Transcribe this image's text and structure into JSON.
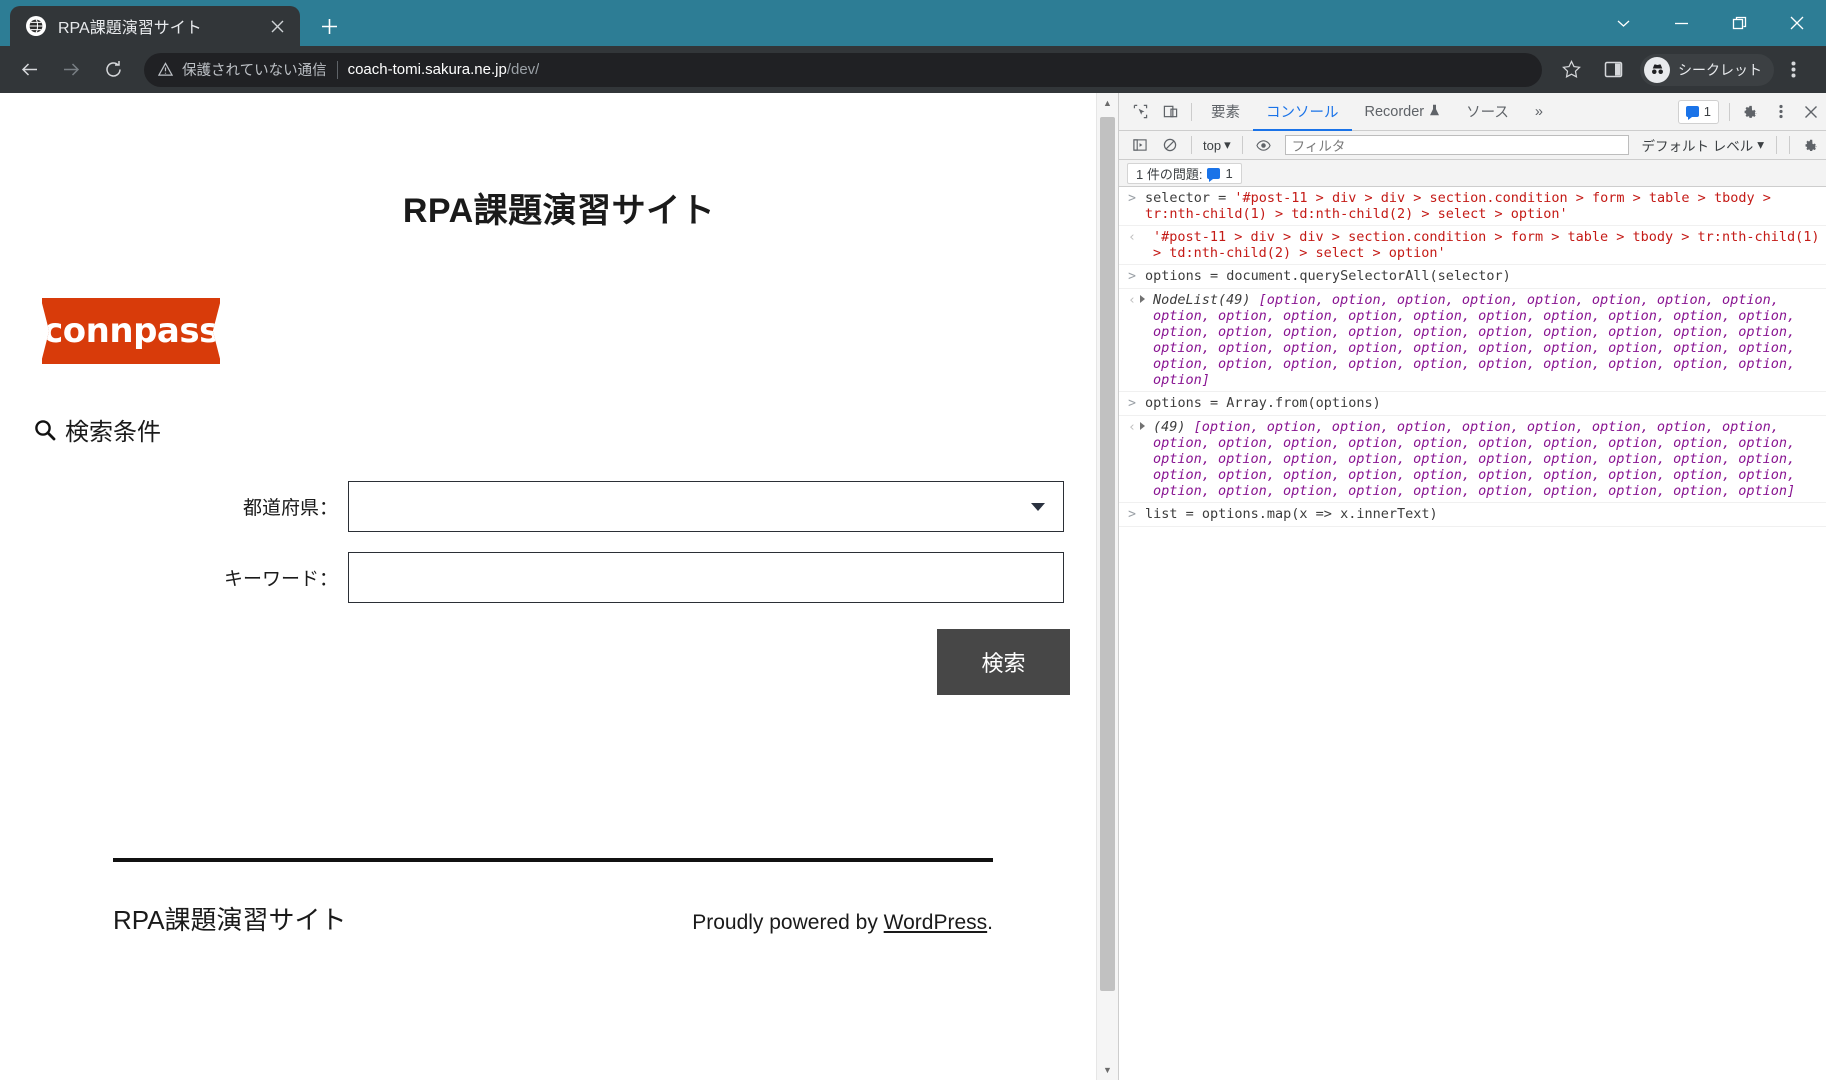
{
  "browser": {
    "tab": {
      "title": "RPA課題演習サイト",
      "favicon_icon": "globe-icon",
      "close_icon": "close-icon"
    },
    "new_tab_icon": "plus-icon",
    "window_controls": {
      "expand_icon": "chevron-down-icon",
      "minimize_icon": "minimize-icon",
      "maximize_icon": "maximize-icon",
      "close_icon": "close-icon"
    },
    "toolbar": {
      "back_icon": "back-arrow-icon",
      "forward_icon": "forward-arrow-icon",
      "reload_icon": "reload-icon",
      "security_icon": "warning-triangle-icon",
      "security_text": "保護されていない通信",
      "url_host": "coach-tomi.sakura.ne.jp",
      "url_path": "/dev/",
      "bookmark_icon": "star-icon",
      "sidepanel_icon": "side-panel-icon",
      "incognito_icon": "incognito-icon",
      "incognito_label": "シークレット",
      "menu_icon": "three-dot-menu-icon"
    }
  },
  "page": {
    "site_title": "RPA課題演習サイト",
    "logo_text": "connpass",
    "search_heading": {
      "icon": "magnifier-icon",
      "label": "検索条件"
    },
    "form": {
      "rows": [
        {
          "label": "都道府県：",
          "type": "select",
          "value": "",
          "caret_icon": "caret-down-icon"
        },
        {
          "label": "キーワード：",
          "type": "text",
          "value": "",
          "placeholder": ""
        }
      ],
      "submit_label": "検索"
    },
    "footer": {
      "site_name": "RPA課題演習サイト",
      "credit_prefix": "Proudly powered by ",
      "credit_link": "WordPress",
      "credit_suffix": "."
    },
    "scrollbar": {
      "up_icon": "scroll-up-icon",
      "down_icon": "scroll-down-icon"
    }
  },
  "devtools": {
    "toolbar": {
      "inspect_icon": "inspect-element-icon",
      "device_icon": "device-toolbar-icon",
      "settings_icon": "gear-icon",
      "more_icon": "three-dot-menu-icon",
      "close_icon": "close-icon",
      "issues_count": "1"
    },
    "tabs": [
      {
        "label": "要素",
        "active": false
      },
      {
        "label": "コンソール",
        "active": true
      },
      {
        "label": "Recorder",
        "active": false,
        "badge_icon": "flask-icon"
      },
      {
        "label": "ソース",
        "active": false
      },
      {
        "label": "»",
        "active": false
      }
    ],
    "console_toolbar": {
      "execute_icon": "sidebar-toggle-icon",
      "clear_icon": "clear-console-icon",
      "context": "top",
      "context_caret": "caret-down-icon",
      "eye_icon": "live-expression-eye-icon",
      "filter_placeholder": "フィルタ",
      "level": "デフォルト レベル",
      "level_caret": "caret-down-icon",
      "settings_icon": "gear-icon"
    },
    "issue_bar": {
      "label": "1 件の問題:",
      "count": "1",
      "bubble_icon": "issue-bubble-icon"
    },
    "console_lines": [
      {
        "kind": "input",
        "parts": [
          {
            "t": "plain",
            "v": "selector = "
          },
          {
            "t": "str",
            "v": "'#post-11 > div > div > section.condition > form > table > tbody > tr:nth-child(1) > td:nth-child(2) > select > option'"
          }
        ]
      },
      {
        "kind": "output",
        "parts": [
          {
            "t": "str",
            "v": "'#post-11 > div > div > section.condition > form > table > tbody > tr:nth-child(1) > td:nth-child(2) > select > option'"
          }
        ]
      },
      {
        "kind": "input",
        "parts": [
          {
            "t": "plain",
            "v": "options = document.querySelectorAll(selector)"
          }
        ]
      },
      {
        "kind": "output",
        "expandable": true,
        "parts": [
          {
            "t": "num",
            "v": "NodeList(49) "
          },
          {
            "t": "obj",
            "v": "[option, option, option, option, option, option, option, option, option, option, option, option, option, option, option, option, option, option, option, option, option, option, option, option, option, option, option, option, option, option, option, option, option, option, option, option, option, option, option, option, option, option, option, option, option, option, option, option, option]"
          }
        ]
      },
      {
        "kind": "input",
        "parts": [
          {
            "t": "plain",
            "v": "options = Array.from(options)"
          }
        ]
      },
      {
        "kind": "output",
        "expandable": true,
        "parts": [
          {
            "t": "num",
            "v": "(49) "
          },
          {
            "t": "obj",
            "v": "[option, option, option, option, option, option, option, option, option, option, option, option, option, option, option, option, option, option, option, option, option, option, option, option, option, option, option, option, option, option, option, option, option, option, option, option, option, option, option, option, option, option, option, option, option, option, option, option, option]"
          }
        ]
      },
      {
        "kind": "input",
        "parts": [
          {
            "t": "plain",
            "v": "list = options.map(x => x.innerText)"
          }
        ]
      }
    ]
  },
  "colors": {
    "tabstrip": "#2d7d95",
    "chrome_dark": "#323639",
    "devtools_accent": "#1a73e8",
    "connpass_red": "#d83b0a",
    "button_gray": "#474747"
  }
}
